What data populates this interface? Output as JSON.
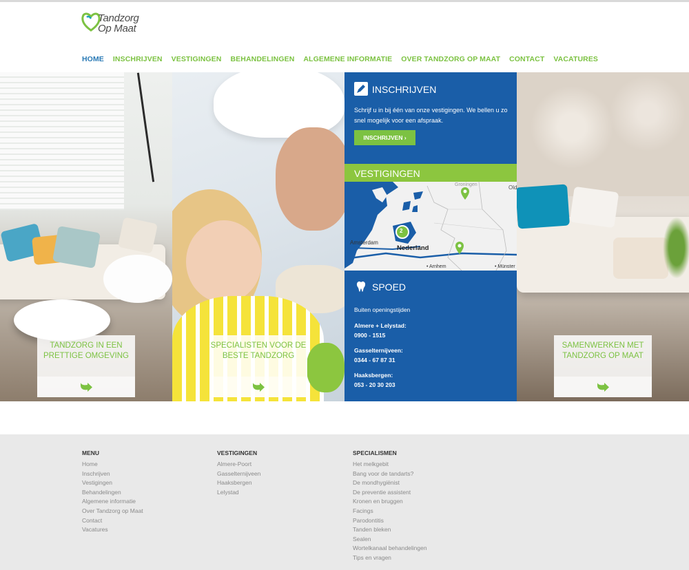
{
  "logo": {
    "line1": "Tandzorg",
    "line2": "Op Maat"
  },
  "nav": {
    "items": [
      "HOME",
      "INSCHRIJVEN",
      "VESTIGINGEN",
      "BEHANDELINGEN",
      "ALGEMENE INFORMATIE",
      "OVER TANDZORG OP MAAT",
      "CONTACT",
      "VACATURES"
    ],
    "active_index": 0
  },
  "panels": {
    "card1": "TANDZORG IN EEN PRETTIGE OMGEVING",
    "card2": "SPECIALISTEN VOOR DE BESTE TANDZORG",
    "card4": "SAMENWERKEN MET TANDZORG OP MAAT"
  },
  "inschrijven": {
    "title": "INSCHRIJVEN",
    "description": "Schrijf u in bij één van onze vestigingen. We bellen u zo snel mogelijk voor een afspraak.",
    "button": "INSCHRIJVEN ›"
  },
  "vestigingen": {
    "title": "VESTIGINGEN",
    "map_labels": {
      "amsterdam": "Amsterdam",
      "nederland": "Nederland",
      "groningen": "Groningen",
      "arnhem": "• Arnhem",
      "munster": "• Münster",
      "old": "Old",
      "cluster_count": "2"
    }
  },
  "spoed": {
    "title": "SPOED",
    "subtitle": "Buiten openingstijden",
    "entries": [
      {
        "location": "Almere + Lelystad:",
        "phone": "0900 - 1515"
      },
      {
        "location": "Gasselternijveen:",
        "phone": "0344 - 67 87 31"
      },
      {
        "location": "Haaksbergen:",
        "phone": "053 - 20 30 203"
      }
    ]
  },
  "footer": {
    "menu": {
      "heading": "MENU",
      "items": [
        "Home",
        "Inschrijven",
        "Vestigingen",
        "Behandelingen",
        "Algemene informatie",
        "Over Tandzorg op Maat",
        "Contact",
        "Vacatures"
      ]
    },
    "vestigingen": {
      "heading": "VESTIGINGEN",
      "items": [
        "Almere-Poort",
        "Gasselternijveen",
        "Haaksbergen",
        "Lelystad"
      ]
    },
    "specialismen": {
      "heading": "SPECIALISMEN",
      "items": [
        "Het melkgebit",
        "Bang voor de tandarts?",
        "De mondhygiënist",
        "De preventie assistent",
        "Kronen en bruggen",
        "Facings",
        "Parodontitis",
        "Tanden bleken",
        "Sealen",
        "Wortelkanaal behandelingen",
        "Tips en vragen"
      ]
    }
  },
  "colors": {
    "brand_green": "#7cc242",
    "brand_blue": "#1a5ea8",
    "nav_active": "#2a7ab5",
    "footer_bg": "#e9e9e9"
  }
}
